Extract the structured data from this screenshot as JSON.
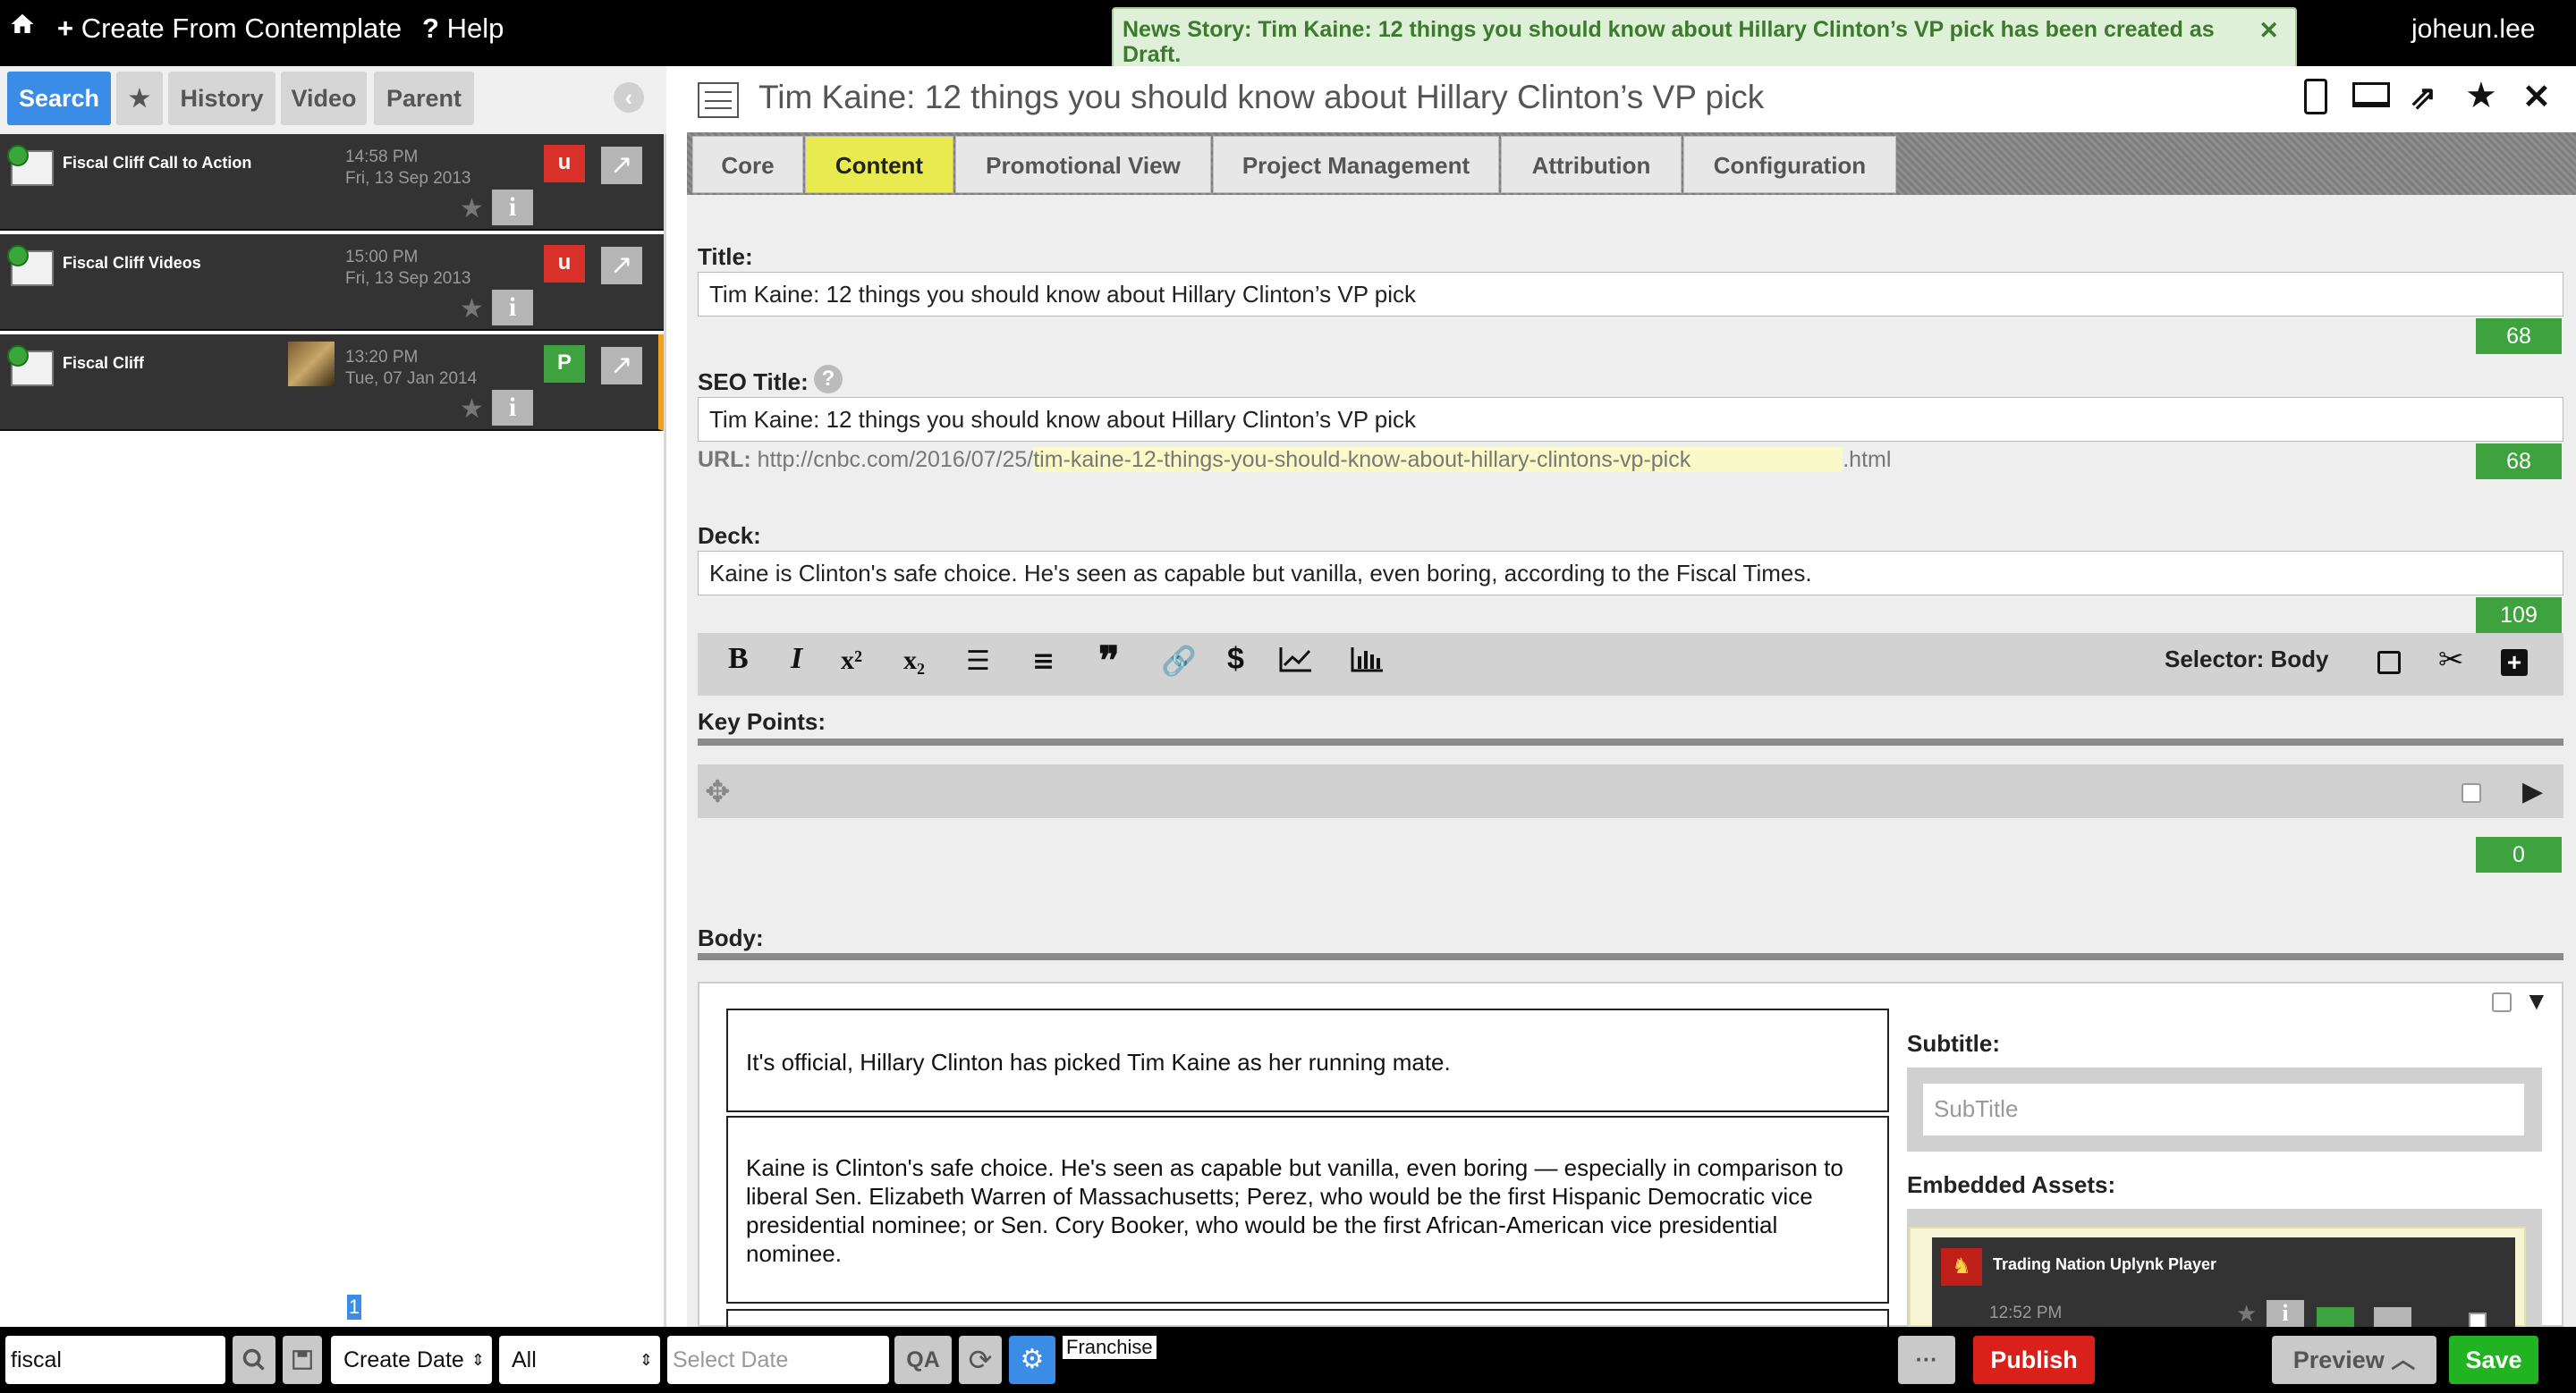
{
  "topbar": {
    "create_label": "Create From Contemplate",
    "help_label": "Help",
    "user": "joheun.lee",
    "notice": "News Story: Tim Kaine: 12 things you should know about Hillary Clinton’s VP pick has been created as Draft."
  },
  "left": {
    "tabs": [
      "Search",
      "★",
      "History",
      "Video",
      "Parent"
    ],
    "results": [
      {
        "title": "Fiscal Cliff Call to Action",
        "time": "14:58 PM",
        "date": "Fri, 13 Sep 2013",
        "badge": "u",
        "badge_color": "#d9302a"
      },
      {
        "title": "Fiscal Cliff Videos",
        "time": "15:00 PM",
        "date": "Fri, 13 Sep 2013",
        "badge": "u",
        "badge_color": "#d9302a"
      },
      {
        "title": "Fiscal Cliff",
        "time": "13:20 PM",
        "date": "Tue, 07 Jan 2014",
        "badge": "P",
        "badge_color": "#3ea33e"
      }
    ],
    "page": "1"
  },
  "bottom": {
    "search_value": "fiscal",
    "sort": "Create Date",
    "filter": "All",
    "date_placeholder": "Select Date",
    "franchise": "Franchise",
    "more": "···",
    "publish": "Publish",
    "preview": "Preview",
    "save": "Save"
  },
  "editor": {
    "header_title": "Tim Kaine: 12 things you should know about Hillary Clinton’s VP pick",
    "tabs": [
      "Core",
      "Content",
      "Promotional View",
      "Project Management",
      "Attribution",
      "Configuration"
    ],
    "title_label": "Title:",
    "title_value": "Tim Kaine: 12 things you should know about Hillary Clinton’s VP pick",
    "title_count": "68",
    "seo_label": "SEO Title:",
    "seo_value": "Tim Kaine: 12 things you should know about Hillary Clinton’s VP pick",
    "seo_count": "68",
    "url_label": "URL:",
    "url_base": "http://cnbc.com/2016/07/25/",
    "url_slug": "tim-kaine-12-things-you-should-know-about-hillary-clintons-vp-pick",
    "url_ext": ".html",
    "deck_label": "Deck:",
    "deck_value": "Kaine is Clinton's safe choice. He's seen as capable but vanilla, even boring, according to the Fiscal Times.",
    "deck_count": "109",
    "selector_label": "Selector: Body",
    "keypoints_label": "Key Points:",
    "keypoints_count": "0",
    "body_label": "Body:",
    "paragraphs": [
      "It's official, Hillary Clinton has picked Tim Kaine as her running mate.",
      "Kaine is Clinton's safe choice. He's seen as capable but vanilla, even boring — especially in comparison to liberal Sen. Elizabeth Warren of Massachusetts; Perez, who would be the first Hispanic Democratic vice presidential nominee; or Sen. Cory Booker, who would be the first African-American vice presidential nominee."
    ],
    "subtitle_label": "Subtitle:",
    "subtitle_placeholder": "SubTitle",
    "embedded_label": "Embedded Assets:",
    "asset_title": "Trading Nation Uplynk Player",
    "asset_time": "12:52 PM"
  },
  "colors": {
    "accent_blue": "#3b8ce6",
    "green": "#3ea33e",
    "red": "#d9302a",
    "tab_active": "#e8ea4f"
  }
}
